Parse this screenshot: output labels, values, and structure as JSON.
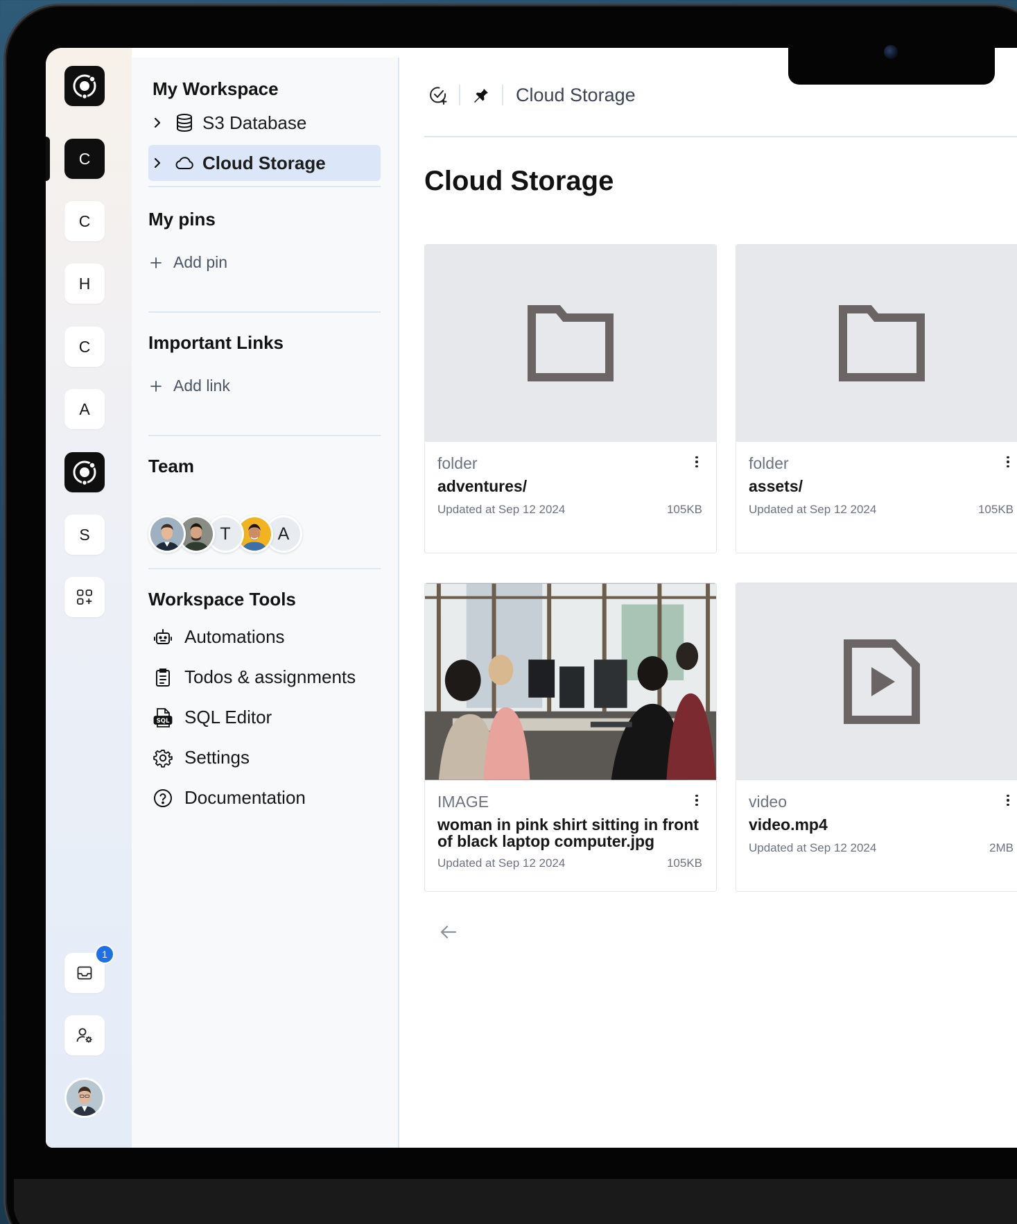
{
  "workspace": {
    "heading": "My Workspace",
    "tree": [
      {
        "label": "S3 Database",
        "icon": "database-icon",
        "active": false
      },
      {
        "label": "Cloud Storage",
        "icon": "cloud-icon",
        "active": true
      }
    ]
  },
  "pins": {
    "heading": "My pins",
    "add_label": "Add pin"
  },
  "links": {
    "heading": "Important Links",
    "add_label": "Add link"
  },
  "team": {
    "heading": "Team",
    "members": [
      {
        "initial": "",
        "kind": "photo"
      },
      {
        "initial": "",
        "kind": "photo"
      },
      {
        "initial": "T",
        "kind": "letter"
      },
      {
        "initial": "",
        "kind": "photo"
      },
      {
        "initial": "A",
        "kind": "letter"
      }
    ]
  },
  "tools": {
    "heading": "Workspace Tools",
    "items": [
      {
        "label": "Automations",
        "icon": "robot-icon"
      },
      {
        "label": "Todos & assignments",
        "icon": "clipboard-icon"
      },
      {
        "label": "SQL Editor",
        "icon": "sql-file-icon"
      },
      {
        "label": "Settings",
        "icon": "gear-icon"
      },
      {
        "label": "Documentation",
        "icon": "help-circle-icon"
      }
    ]
  },
  "rail": {
    "items": [
      "C",
      "C",
      "H",
      "C",
      "A",
      "S"
    ],
    "notification_count": "1"
  },
  "header": {
    "breadcrumb": "Cloud Storage"
  },
  "page": {
    "title": "Cloud Storage"
  },
  "files": [
    {
      "kind": "folder",
      "name": "adventures/",
      "updated": "Updated at Sep 12 2024",
      "size": "105KB",
      "thumb": "folder-icon"
    },
    {
      "kind": "folder",
      "name": "assets/",
      "updated": "Updated at Sep 12 2024",
      "size": "105KB",
      "thumb": "folder-icon"
    },
    {
      "kind": "IMAGE",
      "name": "woman in pink shirt sitting in front of black laptop computer.jpg",
      "updated": "Updated at Sep 12 2024",
      "size": "105KB",
      "thumb": "photo"
    },
    {
      "kind": "video",
      "name": "video.mp4",
      "updated": "Updated at Sep 12 2024",
      "size": "2MB",
      "thumb": "video-file-icon"
    }
  ],
  "colors": {
    "accent": "#1f6fe5",
    "active_bg": "#dbe7f9",
    "thumb_bg": "#e6e8ec",
    "icon_gray": "#6b6464"
  }
}
